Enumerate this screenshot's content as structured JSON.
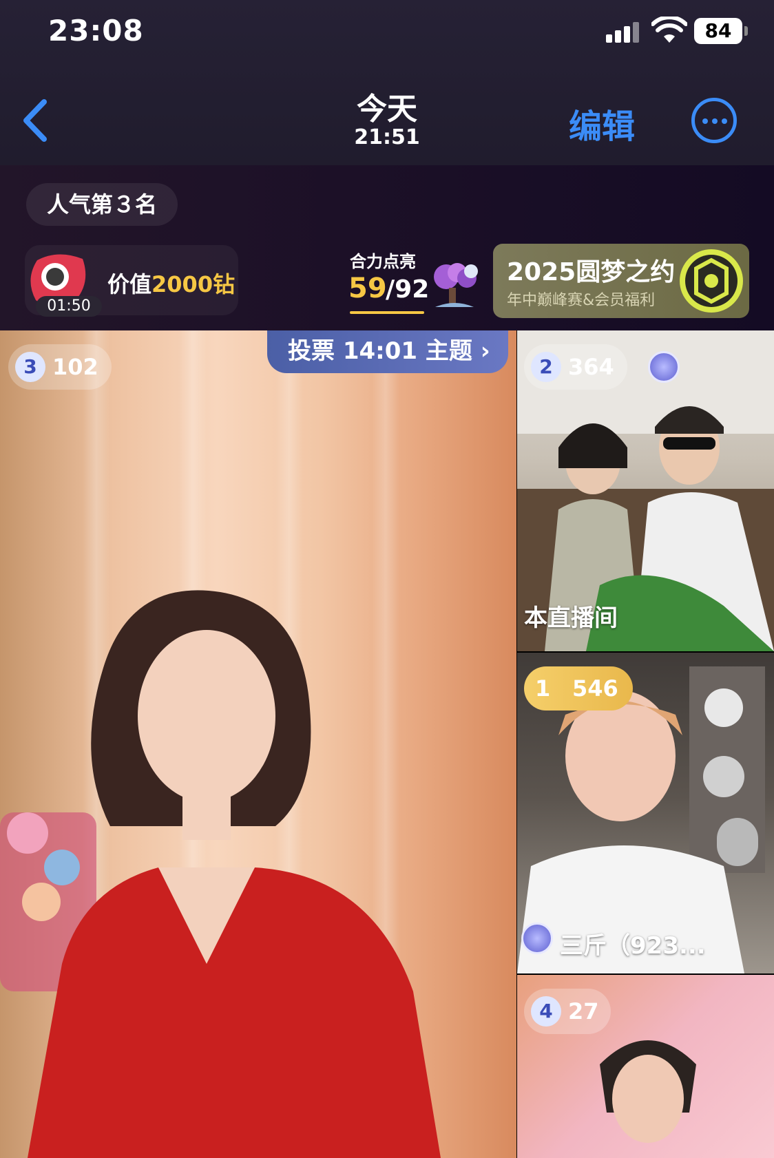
{
  "status_bar": {
    "time": "23:08",
    "battery": "84"
  },
  "nav": {
    "title": "今天",
    "subtitle": "21:51",
    "edit_label": "编辑"
  },
  "live_header": {
    "rank": "人气第３名",
    "gift_timer": "01:50",
    "gift_prefix": "价值",
    "gift_amount": "2000钻",
    "light_title": "合力点亮",
    "light_current": "59",
    "light_total": "/92",
    "light_progress": 0.64,
    "promo_title": "2025圆梦之约",
    "promo_subtitle": "年中巅峰赛&会员福利"
  },
  "main_stream": {
    "vote_label": "投票 14:01 主题 ›",
    "rank": "3",
    "count": "102"
  },
  "side_streams": [
    {
      "rank": "2",
      "count": "364",
      "label": "本直播间"
    },
    {
      "rank": "1",
      "count": "546",
      "label": "三斤（923..."
    },
    {
      "rank": "4",
      "count": "27"
    }
  ],
  "colors": {
    "accent_blue": "#3b8cf7",
    "gold": "#f6c744"
  }
}
